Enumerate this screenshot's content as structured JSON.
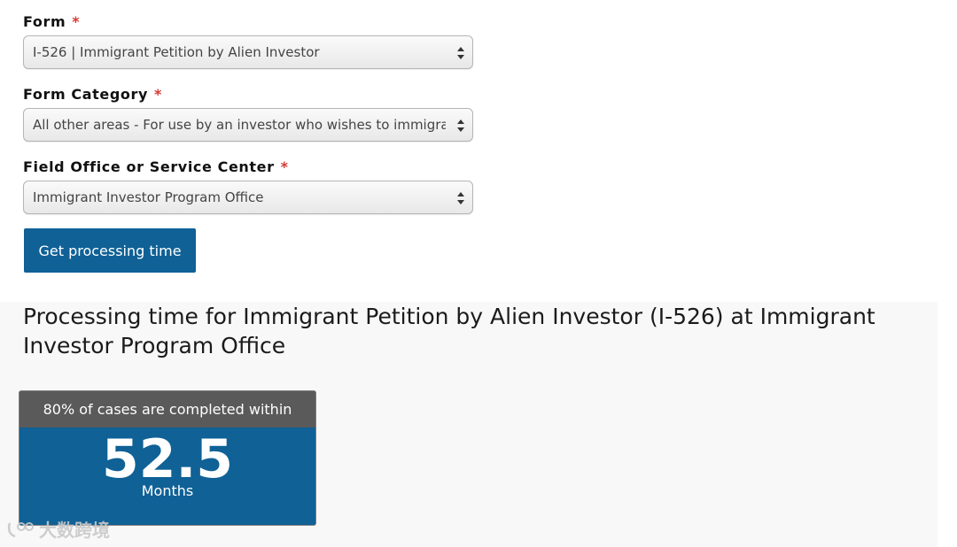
{
  "form": {
    "fields": [
      {
        "label": "Form",
        "required_marker": "*",
        "value": "I-526 | Immigrant Petition by Alien Investor"
      },
      {
        "label": "Form Category",
        "required_marker": "*",
        "value": "All other areas - For use by an investor who wishes to immigrate t"
      },
      {
        "label": "Field Office or Service Center",
        "required_marker": "*",
        "value": "Immigrant Investor Program Office"
      }
    ],
    "submit_label": "Get processing time"
  },
  "result": {
    "title": "Processing time for Immigrant Petition by Alien Investor (I-526) at Immigrant Investor Program Office",
    "card": {
      "header": "80% of cases are completed within",
      "value": "52.5",
      "unit": "Months"
    }
  },
  "watermark": {
    "text": "大数跨境"
  },
  "colors": {
    "primary": "#0f6196",
    "required": "#d83933",
    "card_header": "#5a5a5a",
    "panel_bg": "#f8f8f8"
  }
}
